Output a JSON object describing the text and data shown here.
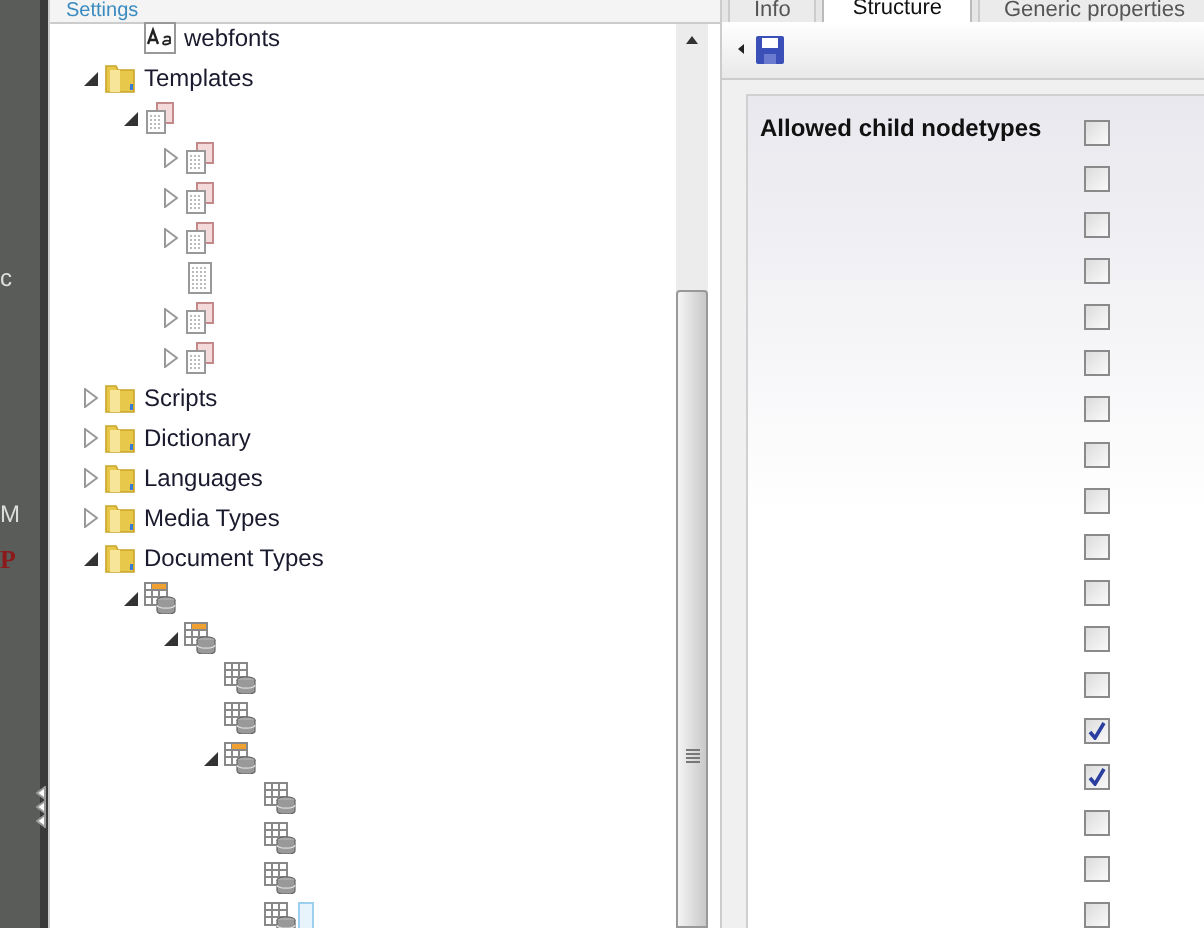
{
  "background_letters": [
    "c",
    "M",
    "P"
  ],
  "tree_panel": {
    "title": "Settings"
  },
  "tree": [
    {
      "children": [
        {
          "label": "webfonts",
          "kind": "font"
        }
      ]
    },
    {
      "label": "Templates",
      "kind": "folder",
      "expanded": true,
      "children": [
        {
          "kind": "template-stack",
          "expanded": true,
          "children": [
            {
              "kind": "template-stack",
              "expanded": false
            },
            {
              "kind": "template-stack",
              "expanded": false
            },
            {
              "kind": "template-stack",
              "expanded": false
            },
            {
              "kind": "template"
            },
            {
              "kind": "template-stack",
              "expanded": false
            },
            {
              "kind": "template-stack",
              "expanded": false
            }
          ]
        }
      ]
    },
    {
      "label": "Scripts",
      "kind": "folder",
      "expanded": false
    },
    {
      "label": "Dictionary",
      "kind": "folder",
      "expanded": false
    },
    {
      "label": "Languages",
      "kind": "folder",
      "expanded": false
    },
    {
      "label": "Media Types",
      "kind": "folder",
      "expanded": false
    },
    {
      "label": "Document Types",
      "kind": "folder",
      "expanded": true,
      "children": [
        {
          "kind": "doctype-parent",
          "expanded": true,
          "children": [
            {
              "kind": "doctype-parent",
              "expanded": true,
              "children": [
                {
                  "kind": "doctype"
                },
                {
                  "kind": "doctype"
                },
                {
                  "kind": "doctype-parent",
                  "expanded": true,
                  "children": [
                    {
                      "kind": "doctype",
                      "selected": false
                    },
                    {
                      "kind": "doctype",
                      "selected": false
                    },
                    {
                      "kind": "doctype",
                      "selected": false
                    },
                    {
                      "kind": "doctype",
                      "selected": true
                    }
                  ]
                }
              ]
            }
          ]
        }
      ]
    }
  ],
  "tabs": [
    {
      "label": "Info",
      "selected": false
    },
    {
      "label": "Structure",
      "selected": true
    },
    {
      "label": "Generic properties",
      "selected": false
    }
  ],
  "structure": {
    "label": "Allowed child nodetypes",
    "options": [
      {
        "checked": false
      },
      {
        "checked": false
      },
      {
        "checked": false
      },
      {
        "checked": false
      },
      {
        "checked": false
      },
      {
        "checked": false
      },
      {
        "checked": false
      },
      {
        "checked": false
      },
      {
        "checked": false
      },
      {
        "checked": false
      },
      {
        "checked": false
      },
      {
        "checked": false
      },
      {
        "checked": false
      },
      {
        "checked": true
      },
      {
        "checked": true
      },
      {
        "checked": false
      },
      {
        "checked": false
      },
      {
        "checked": false
      }
    ]
  }
}
